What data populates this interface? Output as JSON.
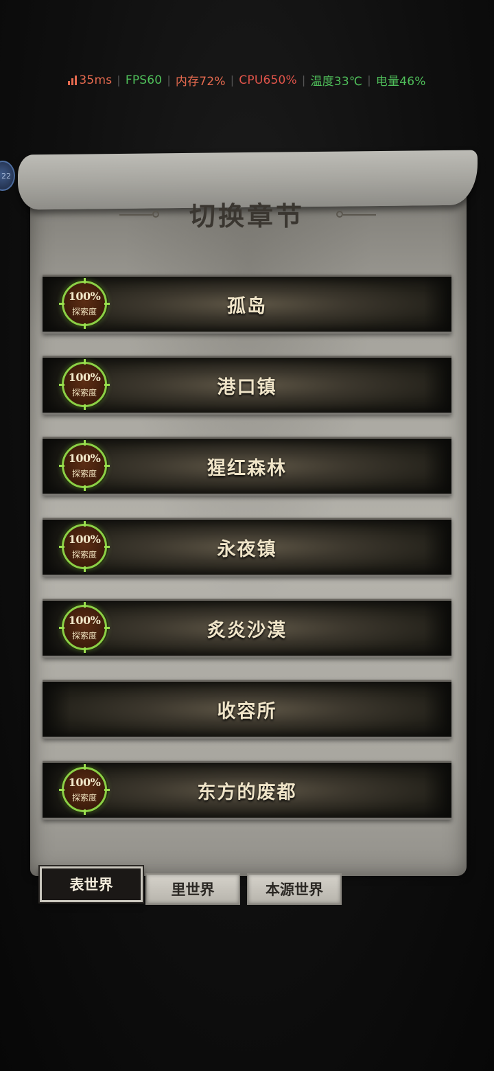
{
  "perf_overlay": {
    "latency": "35ms",
    "fps": "FPS60",
    "memory": "内存72%",
    "cpu": "CPU650%",
    "temperature": "温度33℃",
    "battery": "电量46%",
    "colors": {
      "latency": "#e66a4f",
      "fps": "#4fbf5a",
      "memory": "#e66a4f",
      "cpu": "#e0544a",
      "temperature": "#4fbf5a",
      "battery": "#4fbf5a"
    }
  },
  "side_bubble": {
    "text": "22"
  },
  "panel": {
    "title": "切换章节"
  },
  "chapters": [
    {
      "name": "孤岛",
      "explore_percent": "100%",
      "explore_label": "探索度"
    },
    {
      "name": "港口镇",
      "explore_percent": "100%",
      "explore_label": "探索度"
    },
    {
      "name": "猩红森林",
      "explore_percent": "100%",
      "explore_label": "探索度"
    },
    {
      "name": "永夜镇",
      "explore_percent": "100%",
      "explore_label": "探索度"
    },
    {
      "name": "炙炎沙漠",
      "explore_percent": "100%",
      "explore_label": "探索度"
    },
    {
      "name": "收容所"
    },
    {
      "name": "东方的废都",
      "explore_percent": "100%",
      "explore_label": "探索度"
    }
  ],
  "world_tabs": [
    {
      "label": "表世界",
      "active": true
    },
    {
      "label": "里世界",
      "active": false
    },
    {
      "label": "本源世界",
      "active": false
    }
  ]
}
